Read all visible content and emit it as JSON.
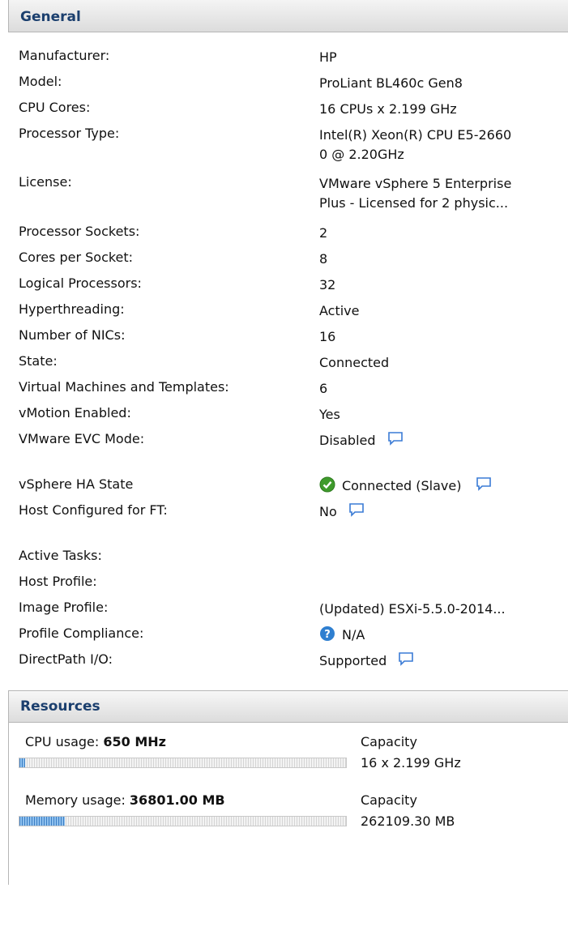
{
  "general": {
    "title": "General",
    "rows": [
      {
        "label": "Manufacturer:",
        "value": "HP"
      },
      {
        "label": "Model:",
        "value": "ProLiant BL460c Gen8"
      },
      {
        "label": "CPU Cores:",
        "value": "16 CPUs x 2.199 GHz"
      },
      {
        "label": "Processor Type:",
        "value": "Intel(R) Xeon(R) CPU E5-2660",
        "value2": "0 @ 2.20GHz"
      },
      {
        "label": "License:",
        "value": "VMware vSphere 5 Enterprise",
        "value2": "Plus - Licensed for 2 physic..."
      },
      {
        "label": "Processor Sockets:",
        "value": "2"
      },
      {
        "label": "Cores per Socket:",
        "value": "8"
      },
      {
        "label": "Logical Processors:",
        "value": "32"
      },
      {
        "label": "Hyperthreading:",
        "value": "Active"
      },
      {
        "label": "Number of NICs:",
        "value": "16"
      },
      {
        "label": "State:",
        "value": "Connected"
      },
      {
        "label": "Virtual Machines and Templates:",
        "value": "6"
      },
      {
        "label": "vMotion Enabled:",
        "value": "Yes"
      },
      {
        "label": "VMware EVC Mode:",
        "value": "Disabled"
      },
      {
        "label": "vSphere HA State",
        "value": "Connected (Slave)"
      },
      {
        "label": "Host Configured for FT:",
        "value": "No"
      },
      {
        "label": "Active Tasks:",
        "value": ""
      },
      {
        "label": "Host Profile:",
        "value": ""
      },
      {
        "label": "Image Profile:",
        "value": "(Updated) ESXi-5.5.0-2014..."
      },
      {
        "label": "Profile Compliance:",
        "value": "N/A"
      },
      {
        "label": "DirectPath I/O:",
        "value": "Supported"
      }
    ]
  },
  "resources": {
    "title": "Resources",
    "cpu": {
      "label": "CPU usage:",
      "value": "650 MHz",
      "capacity_label": "Capacity",
      "capacity": "16 x 2.199 GHz",
      "usage_fraction": 0.018
    },
    "memory": {
      "label": "Memory usage:",
      "value": "36801.00 MB",
      "capacity_label": "Capacity",
      "capacity": "262109.30 MB",
      "usage_fraction": 0.14
    }
  },
  "icons": {
    "comment": "comment-bubble-icon",
    "ha_status": "green-check-circle-icon",
    "help": "blue-question-circle-icon"
  },
  "colors": {
    "header_text": "#1b3f6e",
    "meter_fill": "#3d7fc4",
    "ha_ok": "#3f9b2c",
    "help_blue": "#2f7fd0",
    "comment_blue": "#3a7bd5"
  }
}
